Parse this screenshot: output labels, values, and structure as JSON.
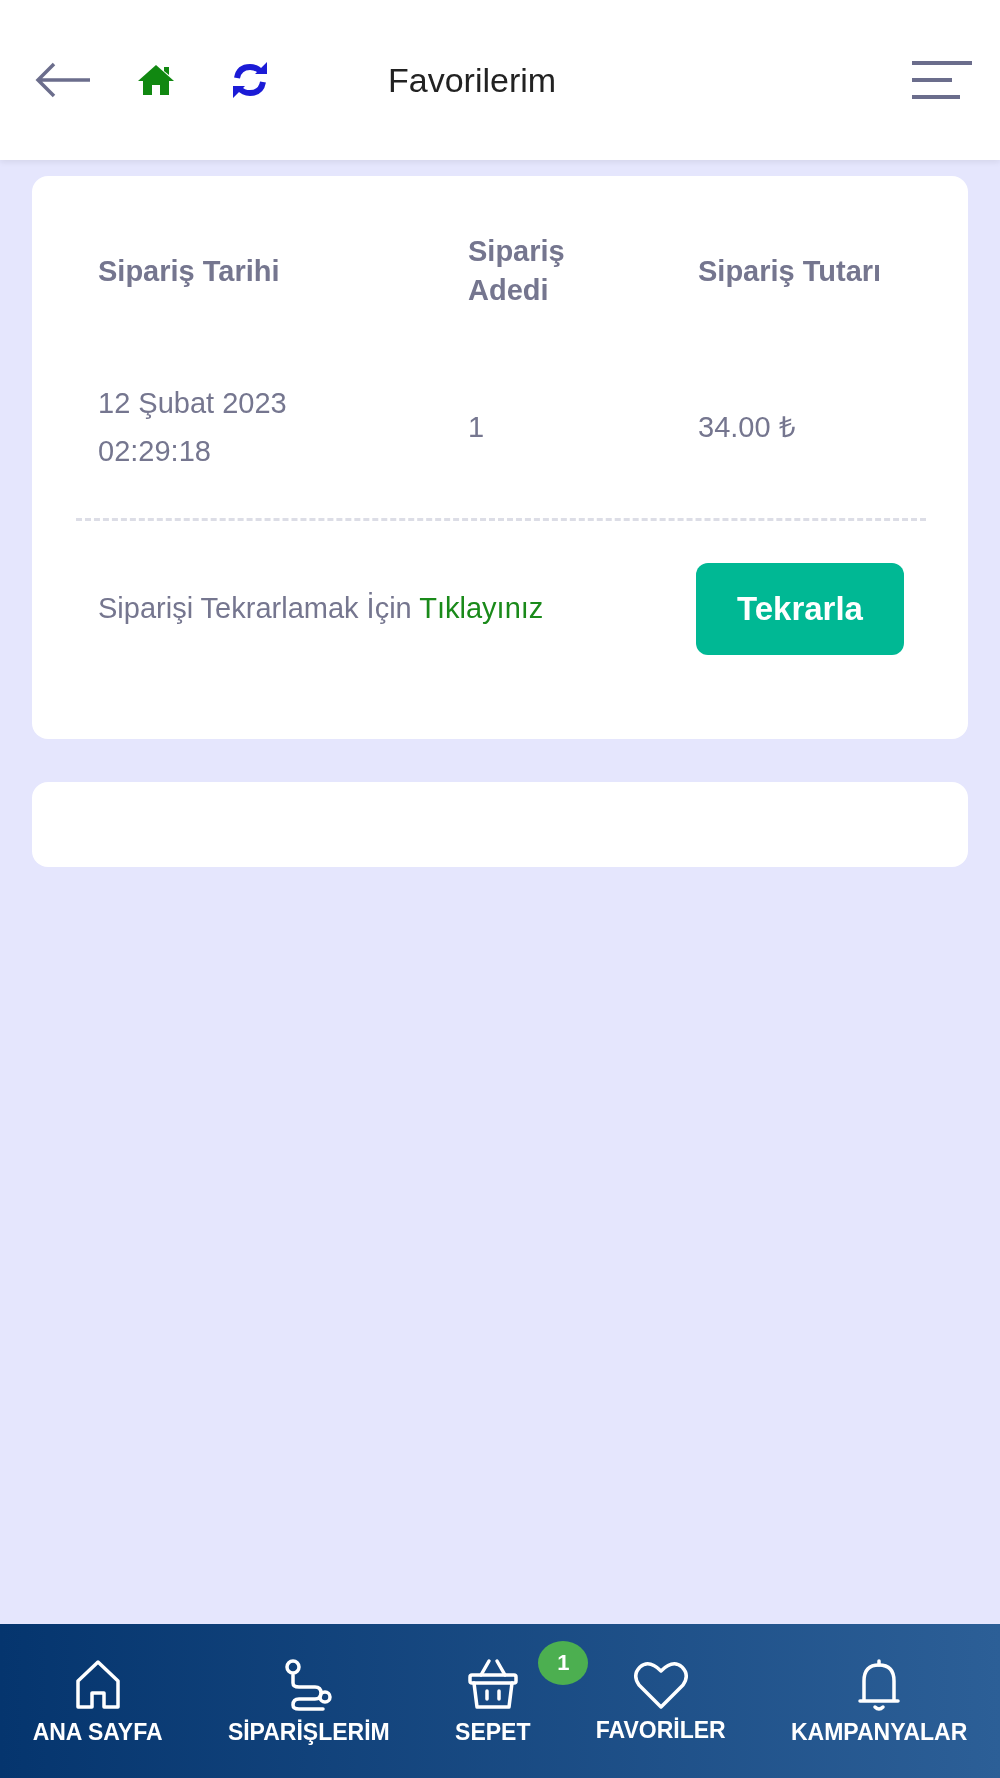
{
  "header": {
    "title": "Favorilerim"
  },
  "order": {
    "columns": [
      "Sipariş Tarihi",
      "Sipariş Adedi",
      "Sipariş Tutarı"
    ],
    "row": [
      "12 Şubat 2023 02:29:18",
      "1",
      "34.00 ₺"
    ],
    "repeat_text": "Siparişi Tekrarlamak İçin",
    "repeat_link": "Tıklayınız",
    "repeat_button": "Tekrarla"
  },
  "bottom_nav": [
    {
      "label": "ANA SAYFA",
      "kind": "home"
    },
    {
      "label": "SİPARİŞLERİM",
      "kind": "route"
    },
    {
      "label": "SEPET",
      "kind": "basket",
      "badge": "1"
    },
    {
      "label": "FAVORİLER",
      "kind": "heart"
    },
    {
      "label": "KAMPANYALAR",
      "kind": "bell"
    }
  ]
}
